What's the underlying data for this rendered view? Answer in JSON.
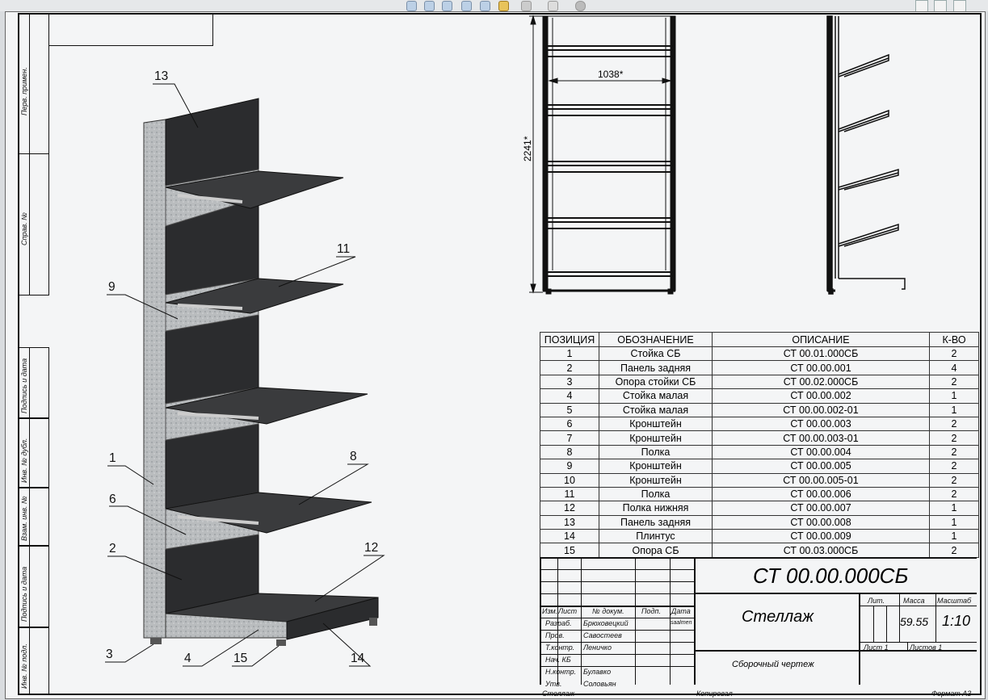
{
  "toolbar": {
    "icons": [
      "zoom-fit-icon",
      "zoom-area-icon",
      "zoom-icon",
      "view-orient-icon",
      "rotate-icon",
      "section-view-icon",
      "display-style-icon",
      "hide-show-icon",
      "appearance-icon"
    ],
    "window_icons": [
      "restore-icon",
      "tile-icon",
      "close-icon"
    ]
  },
  "side_labels": [
    {
      "text": "Перв. примен."
    },
    {
      "text": "Справ. №"
    },
    {
      "text": "Подпись и дата"
    },
    {
      "text": "Инв. № дубл."
    },
    {
      "text": "Взам. инв. №"
    },
    {
      "text": "Подпись и дата"
    },
    {
      "text": "Инв. № подл."
    }
  ],
  "callouts": [
    "13",
    "9",
    "11",
    "1",
    "8",
    "6",
    "2",
    "12",
    "3",
    "4",
    "15",
    "14"
  ],
  "dimensions": {
    "width": "1038*",
    "height": "2241*"
  },
  "bom": {
    "headers": [
      "ПОЗИЦИЯ",
      "ОБОЗНАЧЕНИЕ",
      "ОПИСАНИЕ",
      "К-ВО"
    ],
    "rows": [
      [
        "1",
        "Стойка СБ",
        "СТ 00.01.000СБ",
        "2"
      ],
      [
        "2",
        "Панель задняя",
        "СТ 00.00.001",
        "4"
      ],
      [
        "3",
        "Опора стойки СБ",
        "СТ 00.02.000СБ",
        "2"
      ],
      [
        "4",
        "Стойка малая",
        "СТ 00.00.002",
        "1"
      ],
      [
        "5",
        "Стойка малая",
        "СТ 00.00.002-01",
        "1"
      ],
      [
        "6",
        "Кронштейн",
        "СТ 00.00.003",
        "2"
      ],
      [
        "7",
        "Кронштейн",
        "СТ 00.00.003-01",
        "2"
      ],
      [
        "8",
        "Полка",
        "СТ 00.00.004",
        "2"
      ],
      [
        "9",
        "Кронштейн",
        "СТ 00.00.005",
        "2"
      ],
      [
        "10",
        "Кронштейн",
        "СТ 00.00.005-01",
        "2"
      ],
      [
        "11",
        "Полка",
        "СТ 00.00.006",
        "2"
      ],
      [
        "12",
        "Полка нижняя",
        "СТ 00.00.007",
        "1"
      ],
      [
        "13",
        "Панель задняя",
        "СТ 00.00.008",
        "1"
      ],
      [
        "14",
        "Плинтус",
        "СТ 00.00.009",
        "1"
      ],
      [
        "15",
        "Опора СБ",
        "СТ 00.03.000СБ",
        "2"
      ]
    ]
  },
  "title_block": {
    "designation": "СТ 00.00.000СБ",
    "name": "Стеллаж",
    "doc_type": "Сборочный чертеж",
    "col_izm": "Изм.",
    "col_list": "Лист",
    "col_doc": "№ докум.",
    "col_sign": "Подп.",
    "col_date": "Дата",
    "roles": [
      "Разраб.",
      "Пров.",
      "Т.контр.",
      "Нач. КБ",
      "Н.контр.",
      "Утв."
    ],
    "people": [
      "Брюховецкий",
      "Савостеев",
      "Леничко",
      "",
      "Булавко",
      "Соловьян"
    ],
    "date_small": "saalmen",
    "lit_label": "Лит.",
    "mass_label": "Масса",
    "scale_label": "Масштаб",
    "mass": "59.55",
    "scale": "1:10",
    "sheet": "Лист  1",
    "sheets": "Листов 1",
    "footer_left": "Стеллаж",
    "footer_mid": "Копировал",
    "footer_right": "Формат  А3"
  }
}
